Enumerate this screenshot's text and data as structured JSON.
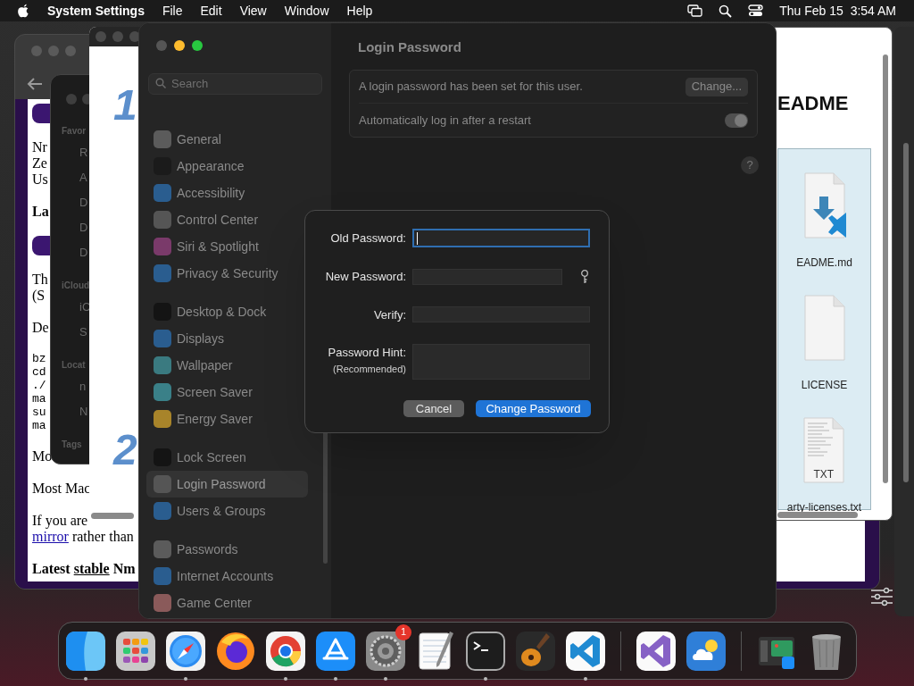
{
  "menu_bar": {
    "app_name": "System Settings",
    "menus": [
      "File",
      "Edit",
      "View",
      "Window",
      "Help"
    ],
    "clock": "Thu Feb 15  3:54 AM"
  },
  "browser_window": {
    "blocks": [
      {
        "kind": "bar"
      },
      {
        "kind": "para",
        "lines": [
          "Nr",
          "Ze",
          "Us"
        ]
      },
      {
        "kind": "heading",
        "lines": [
          "La"
        ]
      },
      {
        "kind": "bar"
      },
      {
        "kind": "para",
        "lines": [
          "Th",
          "(S"
        ]
      },
      {
        "kind": "para",
        "lines": [
          "De"
        ]
      },
      {
        "kind": "code",
        "lines": [
          "bz",
          "cd",
          "./",
          "ma",
          "su",
          "ma"
        ]
      },
      {
        "kind": "para",
        "lines": [
          "Mo"
        ]
      },
      {
        "kind": "para",
        "lines": [
          "Most Mac"
        ]
      },
      {
        "kind": "para",
        "lines": [
          "If you are",
          [
            {
              "text": "mirror",
              "kind": "link"
            },
            {
              "text": " rather than",
              "kind": "plain"
            }
          ]
        ]
      },
      {
        "kind": "heading",
        "lines": [
          [
            {
              "text": "Latest ",
              "kind": "plain"
            },
            {
              "text": "stable",
              "kind": "underlined_link"
            },
            {
              "text": " Nm",
              "kind": "plain"
            }
          ]
        ]
      }
    ]
  },
  "finder_window": {
    "sections": [
      {
        "title": "Favor",
        "items": [
          "R",
          "A",
          "D",
          "D",
          "D"
        ]
      },
      {
        "title": "iCloud",
        "items": [
          "iC",
          "S"
        ]
      },
      {
        "title": "Locat",
        "items": [
          "n",
          "N"
        ]
      },
      {
        "title": "Tags"
      }
    ]
  },
  "document_window": {
    "step_numbers": [
      "1",
      "2"
    ]
  },
  "files_window": {
    "heading": "EADME",
    "files": [
      {
        "name": "EADME.md",
        "kind": "markdown"
      },
      {
        "name": "LICENSE",
        "kind": "plain"
      },
      {
        "name": "arty-licenses.txt",
        "kind": "text",
        "badge": "TXT"
      }
    ]
  },
  "settings_window": {
    "search_placeholder": "Search",
    "sidebar_groups": [
      [
        {
          "label": "General",
          "color": "#5b5b5b",
          "selected": false
        },
        {
          "label": "Appearance",
          "color": "#1b1b1b",
          "selected": false
        },
        {
          "label": "Accessibility",
          "color": "#2a5d8f",
          "selected": false
        },
        {
          "label": "Control Center",
          "color": "#555555",
          "selected": false
        },
        {
          "label": "Siri & Spotlight",
          "color": "#7a3a6a",
          "selected": false
        },
        {
          "label": "Privacy & Security",
          "color": "#2a5d8f",
          "selected": false
        }
      ],
      [
        {
          "label": "Desktop & Dock",
          "color": "#141414",
          "selected": false
        },
        {
          "label": "Displays",
          "color": "#2a5d8f",
          "selected": false
        },
        {
          "label": "Wallpaper",
          "color": "#3a7a80",
          "selected": false
        },
        {
          "label": "Screen Saver",
          "color": "#3a8088",
          "selected": false
        },
        {
          "label": "Energy Saver",
          "color": "#a8842a",
          "selected": false
        }
      ],
      [
        {
          "label": "Lock Screen",
          "color": "#141414",
          "selected": false
        },
        {
          "label": "Login Password",
          "color": "#555555",
          "selected": true
        },
        {
          "label": "Users & Groups",
          "color": "#2a5d8f",
          "selected": false
        }
      ],
      [
        {
          "label": "Passwords",
          "color": "#5b5b5b",
          "selected": false
        },
        {
          "label": "Internet Accounts",
          "color": "#2a5d8f",
          "selected": false
        },
        {
          "label": "Game Center",
          "color": "#8a5a5a",
          "selected": false
        }
      ]
    ],
    "title": "Login Password",
    "password_row": {
      "text": "A login password has been set for this user.",
      "button": "Change..."
    },
    "auto_login": {
      "label": "Automatically log in after a restart",
      "on": true
    },
    "help": "?"
  },
  "password_dialog": {
    "fields": [
      {
        "label": "Old Password:",
        "kind": "line",
        "focused": true,
        "key_icon": false
      },
      {
        "label": "New Password:",
        "kind": "line",
        "focused": false,
        "key_icon": true
      },
      {
        "label": "Verify:",
        "kind": "line",
        "focused": false,
        "key_icon": false
      },
      {
        "label": "Password Hint:",
        "sublabel": "(Recommended)",
        "kind": "box",
        "focused": false,
        "key_icon": false
      }
    ],
    "buttons": [
      {
        "label": "Cancel",
        "kind": "secondary"
      },
      {
        "label": "Change Password",
        "kind": "primary"
      }
    ]
  },
  "dock": {
    "items": [
      {
        "kind": "finder",
        "running": true
      },
      {
        "kind": "launchpad",
        "running": false
      },
      {
        "kind": "safari",
        "running": true
      },
      {
        "kind": "firefox",
        "running": false
      },
      {
        "kind": "chrome",
        "running": true
      },
      {
        "kind": "appstore",
        "running": true
      },
      {
        "kind": "settings",
        "running": true,
        "badge": "1"
      },
      {
        "kind": "textedit",
        "running": false
      },
      {
        "kind": "terminal",
        "running": true
      },
      {
        "kind": "garageband",
        "running": false
      },
      {
        "kind": "vscode",
        "running": true
      },
      {
        "kind": "separator"
      },
      {
        "kind": "visualstudio",
        "running": false
      },
      {
        "kind": "weather",
        "running": false
      },
      {
        "kind": "separator"
      },
      {
        "kind": "stack",
        "running": false
      },
      {
        "kind": "trash",
        "running": false
      }
    ]
  }
}
